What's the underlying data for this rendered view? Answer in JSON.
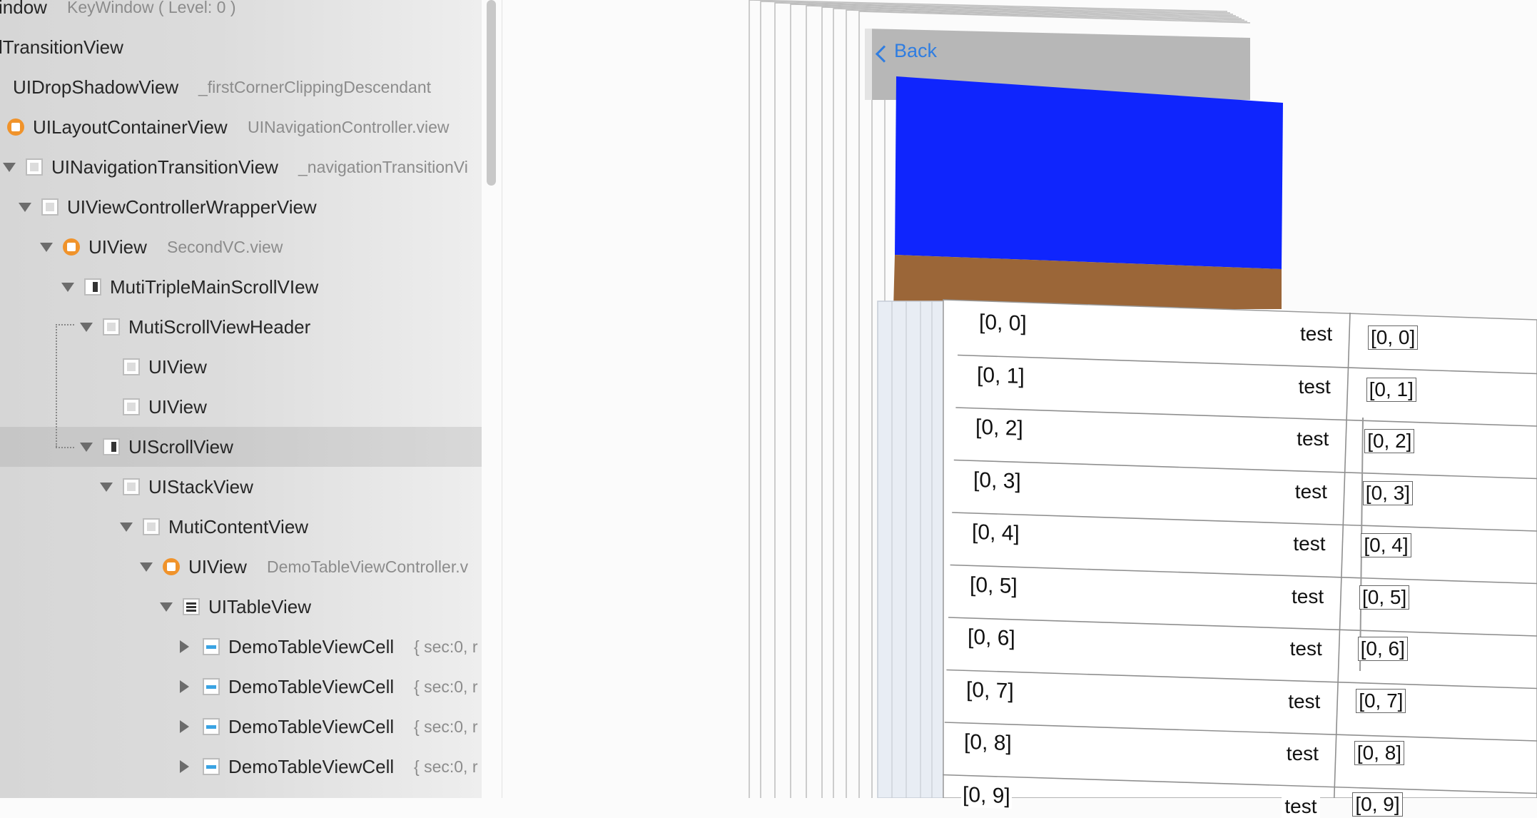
{
  "hierarchy": {
    "rows": [
      {
        "name": "indow",
        "desc": "KeyWindow ( Level: 0 )",
        "icon": "none",
        "tri": "none"
      },
      {
        "name": "lTransitionView",
        "desc": "",
        "icon": "none",
        "tri": "none"
      },
      {
        "name": "UIDropShadowView",
        "desc": "_firstCornerClippingDescendant",
        "icon": "none",
        "tri": "none"
      },
      {
        "name": "UILayoutContainerView",
        "desc": "UINavigationController.view",
        "icon": "view-controller-icon",
        "tri": "none"
      },
      {
        "name": "UINavigationTransitionView",
        "desc": "_navigationTransitionVi",
        "icon": "view-icon",
        "tri": "down"
      },
      {
        "name": "UIViewControllerWrapperView",
        "desc": "",
        "icon": "view-icon",
        "tri": "down"
      },
      {
        "name": "UIView",
        "desc": "SecondVC.view",
        "icon": "view-controller-icon",
        "tri": "down"
      },
      {
        "name": "MutiTripleMainScrollVIew",
        "desc": "",
        "icon": "scroll-view-icon",
        "tri": "down"
      },
      {
        "name": "MutiScrollViewHeader",
        "desc": "",
        "icon": "view-icon",
        "tri": "down"
      },
      {
        "name": "UIView",
        "desc": "",
        "icon": "view-icon",
        "tri": "none"
      },
      {
        "name": "UIView",
        "desc": "",
        "icon": "view-icon",
        "tri": "none"
      },
      {
        "name": "UIScrollView",
        "desc": "",
        "icon": "scroll-view-icon",
        "tri": "down",
        "selected": true
      },
      {
        "name": "UIStackView",
        "desc": "",
        "icon": "view-icon",
        "tri": "down"
      },
      {
        "name": "MutiContentView",
        "desc": "",
        "icon": "view-icon",
        "tri": "down"
      },
      {
        "name": "UIView",
        "desc": "DemoTableViewController.v",
        "icon": "view-controller-icon",
        "tri": "down"
      },
      {
        "name": "UITableView",
        "desc": "",
        "icon": "table-view-icon",
        "tri": "down"
      },
      {
        "name": "DemoTableViewCell",
        "desc": "{ sec:0, r",
        "icon": "table-cell-icon",
        "tri": "right"
      },
      {
        "name": "DemoTableViewCell",
        "desc": "{ sec:0, r",
        "icon": "table-cell-icon",
        "tri": "right"
      },
      {
        "name": "DemoTableViewCell",
        "desc": "{ sec:0, r",
        "icon": "table-cell-icon",
        "tri": "right"
      },
      {
        "name": "DemoTableViewCell",
        "desc": "{ sec:0, r",
        "icon": "table-cell-icon",
        "tri": "right"
      }
    ]
  },
  "preview": {
    "back_label": "Back",
    "colors": {
      "blue_view": "#0f25fd",
      "brown_view": "#9b6638",
      "nav_bar": "#b7b7b7",
      "back_tint": "#2f7de1"
    },
    "table_rows": [
      {
        "left": "[0, 0]",
        "mid": "test",
        "right": "[0, 0]"
      },
      {
        "left": "[0, 1]",
        "mid": "test",
        "right": "[0, 1]"
      },
      {
        "left": "[0, 2]",
        "mid": "test",
        "right": "[0, 2]"
      },
      {
        "left": "[0, 3]",
        "mid": "test",
        "right": "[0, 3]"
      },
      {
        "left": "[0, 4]",
        "mid": "test",
        "right": "[0, 4]"
      },
      {
        "left": "[0, 5]",
        "mid": "test",
        "right": "[0, 5]"
      },
      {
        "left": "[0, 6]",
        "mid": "test",
        "right": "[0, 6]"
      },
      {
        "left": "[0, 7]",
        "mid": "test",
        "right": "[0, 7]"
      },
      {
        "left": "[0, 8]",
        "mid": "test",
        "right": "[0, 8]"
      },
      {
        "left": "[0, 9]",
        "mid": "test",
        "right": "[0, 9]"
      }
    ]
  }
}
